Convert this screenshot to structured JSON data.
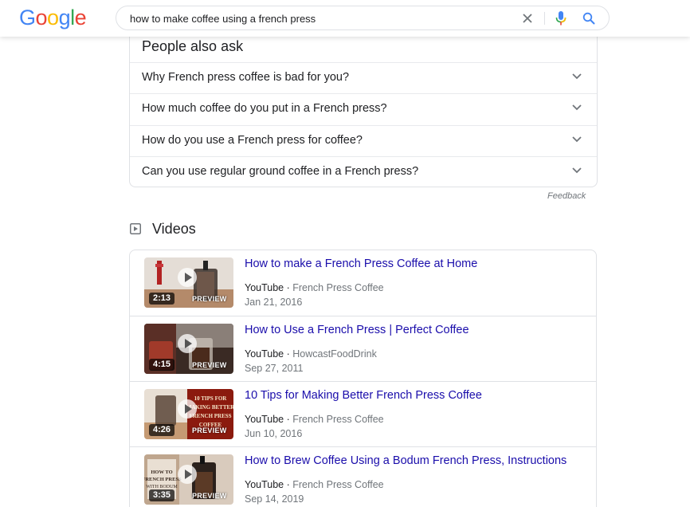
{
  "header": {
    "logo_letters": [
      {
        "char": "G",
        "color": "#4285F4"
      },
      {
        "char": "o",
        "color": "#EA4335"
      },
      {
        "char": "o",
        "color": "#FBBC05"
      },
      {
        "char": "g",
        "color": "#4285F4"
      },
      {
        "char": "l",
        "color": "#34A853"
      },
      {
        "char": "e",
        "color": "#EA4335"
      }
    ],
    "search_query": "how to make coffee using a french press",
    "icons": [
      "close-icon",
      "microphone-icon",
      "search-icon"
    ]
  },
  "people_also_ask": {
    "title": "People also ask",
    "questions": [
      "Why French press coffee is bad for you?",
      "How much coffee do you put in a French press?",
      "How do you use a French press for coffee?",
      "Can you use regular ground coffee in a French press?"
    ],
    "feedback": "Feedback"
  },
  "videos": {
    "title": "Videos",
    "preview_label": "PREVIEW",
    "items": [
      {
        "title": "How to make a French Press Coffee at Home",
        "platform": "YouTube",
        "channel": "French Press Coffee",
        "date": "Jan 21, 2016",
        "duration": "2:13"
      },
      {
        "title": "How to Use a French Press | Perfect Coffee",
        "platform": "YouTube",
        "channel": "HowcastFoodDrink",
        "date": "Sep 27, 2011",
        "duration": "4:15"
      },
      {
        "title": "10 Tips for Making Better French Press Coffee",
        "platform": "YouTube",
        "channel": "French Press Coffee",
        "date": "Jun 10, 2016",
        "duration": "4:26",
        "thumb_text": "10 TIPS FOR MAKING BETTER FRENCH PRESS COFFEE"
      },
      {
        "title": "How to Brew Coffee Using a Bodum French Press, Instructions",
        "platform": "YouTube",
        "channel": "French Press Coffee",
        "date": "Sep 14, 2019",
        "duration": "3:35",
        "thumb_text": "HOW TO FRENCH PRESS WITH BODUM"
      }
    ]
  },
  "colors": {
    "link": "#1a0dab",
    "text": "#202124",
    "muted": "#70757a",
    "border": "#dfe1e5"
  }
}
